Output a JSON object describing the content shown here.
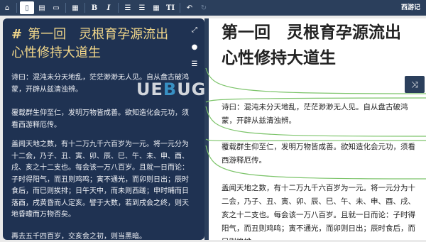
{
  "toolbar": {
    "buttons": [
      {
        "icon": "home-icon",
        "glyph": "⌂"
      },
      {
        "icon": "new-file-icon",
        "glyph": "▯"
      },
      {
        "icon": "save-icon",
        "glyph": "▤"
      },
      {
        "icon": "print-icon",
        "glyph": "▭"
      },
      {
        "icon": "grid-icon",
        "glyph": "▦"
      },
      {
        "icon": "bold-icon",
        "glyph": "B"
      },
      {
        "icon": "italic-icon",
        "glyph": "I"
      },
      {
        "icon": "ordered-list-icon",
        "glyph": "☰"
      },
      {
        "icon": "unordered-list-icon",
        "glyph": "☰"
      },
      {
        "icon": "table-icon",
        "glyph": "▦"
      },
      {
        "icon": "heading-icon",
        "glyph": "TI"
      },
      {
        "icon": "undo-icon",
        "glyph": "↶"
      },
      {
        "icon": "redo-icon",
        "glyph": "↻"
      }
    ],
    "app_title": "西游记"
  },
  "editor": {
    "heading_marker": "#",
    "heading": "第一回　灵根育孕源流出　心性修持大道生",
    "paragraphs": [
      "诗曰：混沌未分天地乱，茫茫渺渺无人见。自从盘古破鸿蒙，开辟从兹清浊辨。",
      "覆载群生仰至仁，发明万物皆成善。欲知造化会元功，须看西游释厄传。",
      "盖闻天地之数，有十二万九千六百岁为一元。将一元分为十二会，乃子、丑、寅、卯、辰、巳、午、未、申、酉、戌、亥之十二支也。每会该一万八百岁。且就一日而论：子时得阳气，而丑则鸡鸣；寅不通光，而卯则日出；辰时食后，而巳则挨排；日午天中，而未则西蹉；申时晡而日落酉，戌黄昏而人定亥。譬于大数，若到戌会之终，则天地昏曚而万物否矣。",
      "再去五千四百岁，交亥会之初，则当黑暗。"
    ]
  },
  "side_tools": [
    {
      "icon": "expand-icon",
      "glyph": "⤢"
    },
    {
      "icon": "ink-drop-icon",
      "glyph": "●"
    },
    {
      "icon": "list-view-icon",
      "glyph": "☰"
    }
  ],
  "preview": {
    "heading": "第一回　灵根育孕源流出　心性修持大道生",
    "paragraphs": [
      "诗曰：混沌未分天地乱，茫茫渺渺无人见。自从盘古破鸿蒙，开辟从兹清浊辨。",
      "覆载群生仰至仁，发明万物皆成善。欲知造化会元功，须看西游释厄传。",
      "盖闻天地之数，有十二万九千六百岁为一元。将一元分为十二会，乃子、丑、寅、卯、辰、巳、午、未、申、酉、戌、亥之十二支也。每会该一万八百岁。且就一日而论：子时得阳气，而丑则鸡鸣；寅不通光，而卯则日出；辰时食后，而巳则挨排。"
    ]
  },
  "sync_button": {
    "icon": "shuffle-icon",
    "glyph": "⤨"
  },
  "watermark": {
    "pre": "UE",
    "c": "B",
    "post": "UG"
  },
  "colors": {
    "toolbar": "#2b3f5c",
    "editor_bg": "#1f3252",
    "heading": "#f2d78a",
    "sync_line": "#7cc46a"
  }
}
